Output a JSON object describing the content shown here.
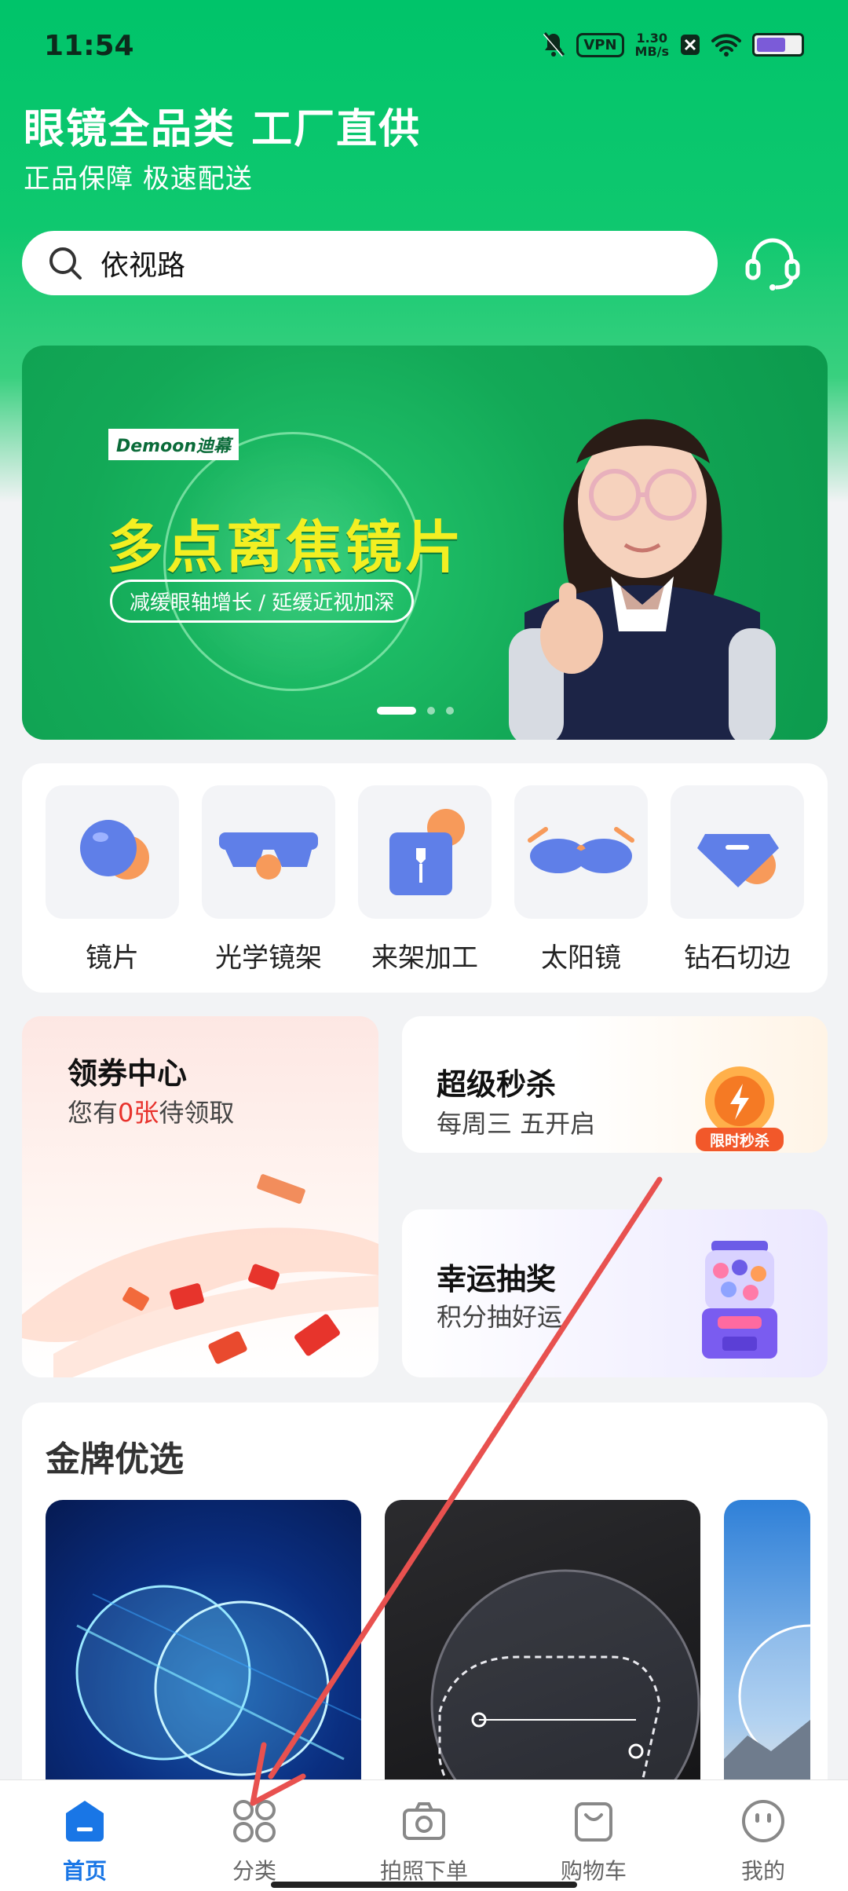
{
  "status_bar": {
    "time": "11:54",
    "vpn": "VPN",
    "speed_value": "1.30",
    "speed_unit": "MB/s"
  },
  "header": {
    "headline": "眼镜全品类 工厂直供",
    "subline": "正品保障 极速配送"
  },
  "search": {
    "text": "依视路",
    "icon": "search-icon",
    "service_icon": "customer-service-icon"
  },
  "banner": {
    "brand": "Demoon迪幕",
    "title": "多点离焦镜片",
    "subtitle": "减缓眼轴增长 / 延缓近视加深",
    "slide_index": 1,
    "slide_count": 3
  },
  "categories": [
    {
      "label": "镜片",
      "icon": "lens-icon"
    },
    {
      "label": "光学镜架",
      "icon": "optical-frame-icon"
    },
    {
      "label": "来架加工",
      "icon": "processing-icon"
    },
    {
      "label": "太阳镜",
      "icon": "sunglasses-icon"
    },
    {
      "label": "钻石切边",
      "icon": "diamond-cut-icon"
    }
  ],
  "promos": {
    "coupon": {
      "title": "领券中心",
      "sub_prefix": "您有",
      "count": "0张",
      "sub_suffix": "待领取"
    },
    "flash": {
      "title": "超级秒杀",
      "sub": "每周三 五开启",
      "badge": "限时秒杀"
    },
    "lucky": {
      "title": "幸运抽奖",
      "sub": "积分抽好运"
    }
  },
  "gold": {
    "title": "金牌优选"
  },
  "tabs": [
    {
      "label": "首页",
      "icon": "home-icon",
      "active": true
    },
    {
      "label": "分类",
      "icon": "category-icon",
      "active": false
    },
    {
      "label": "拍照下单",
      "icon": "camera-icon",
      "active": false
    },
    {
      "label": "购物车",
      "icon": "cart-icon",
      "active": false
    },
    {
      "label": "我的",
      "icon": "profile-icon",
      "active": false
    }
  ],
  "colors": {
    "brand_green": "#00c46a",
    "active_tab": "#1976e6",
    "accent_red": "#e8322c",
    "annotation_arrow": "#e8514f"
  }
}
